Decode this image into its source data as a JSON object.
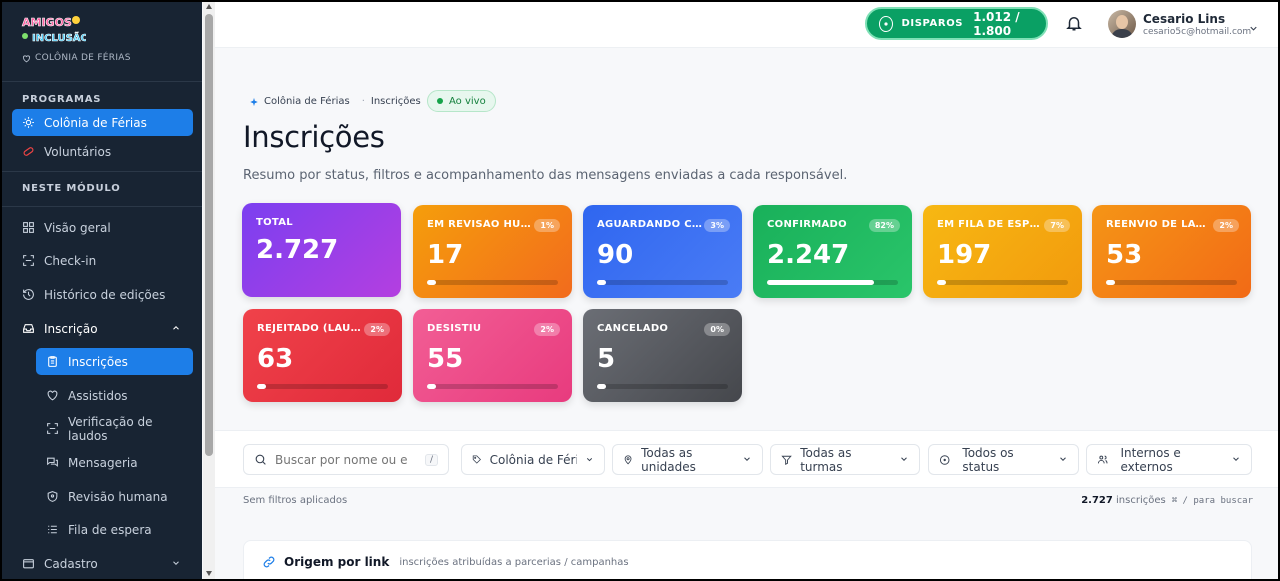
{
  "brand": {
    "logo_text_1": "AMIGOS",
    "logo_text_2": "INCLUSÃO",
    "subtitle": "COLÔNIA DE FÉRIAS"
  },
  "sidebar": {
    "section_programs": "PROGRAMAS",
    "programs": [
      {
        "label": "Colônia de Férias",
        "icon": "sun-icon",
        "active": true
      },
      {
        "label": "Voluntários",
        "icon": "pill-icon",
        "active": false
      }
    ],
    "section_module": "NESTE MÓDULO",
    "module_items": [
      {
        "label": "Visão geral",
        "icon": "grid-icon"
      },
      {
        "label": "Check-in",
        "icon": "scan-icon"
      },
      {
        "label": "Histórico de edições",
        "icon": "history-icon"
      },
      {
        "label": "Inscrição",
        "icon": "inbox-icon"
      }
    ],
    "sub_items": [
      {
        "label": "Inscrições",
        "icon": "clipboard-icon",
        "active": true
      },
      {
        "label": "Assistidos",
        "icon": "heart-icon"
      },
      {
        "label": "Verificação de laudos",
        "icon": "scan-icon"
      },
      {
        "label": "Mensageria",
        "icon": "chat-icon"
      },
      {
        "label": "Revisão humana",
        "icon": "shield-icon"
      },
      {
        "label": "Fila de espera",
        "icon": "list-icon"
      }
    ],
    "cadastro": {
      "label": "Cadastro",
      "icon": "folder-icon"
    }
  },
  "header": {
    "disparos_label": "DISPAROS",
    "disparos_value": "1.012 / 1.800",
    "user_name": "Cesario Lins",
    "user_email": "cesario5c@hotmail.com"
  },
  "breadcrumb": {
    "program": "Colônia de Férias",
    "page": "Inscrições",
    "status": "Ao vivo"
  },
  "page": {
    "title": "Inscrições",
    "subtitle": "Resumo por status, filtros e acompanhamento das mensagens enviadas a cada responsável."
  },
  "cards": [
    {
      "label": "TOTAL",
      "value": "2.727",
      "pct": "",
      "fill": 0
    },
    {
      "label": "EM REVISÃO HUMANA",
      "value": "17",
      "pct": "1%",
      "fill": 0.01
    },
    {
      "label": "AGUARDANDO CONFIRMAÇÃO",
      "value": "90",
      "pct": "3%",
      "fill": 0.03
    },
    {
      "label": "CONFIRMADO",
      "value": "2.247",
      "pct": "82%",
      "fill": 0.82
    },
    {
      "label": "EM FILA DE ESPERA",
      "value": "197",
      "pct": "7%",
      "fill": 0.07
    },
    {
      "label": "REENVIO DE LAUDO",
      "value": "53",
      "pct": "2%",
      "fill": 0.02
    },
    {
      "label": "REJEITADO (LAUDO)",
      "value": "63",
      "pct": "2%",
      "fill": 0.02
    },
    {
      "label": "DESISTIU",
      "value": "55",
      "pct": "2%",
      "fill": 0.02
    },
    {
      "label": "CANCELADO",
      "value": "5",
      "pct": "0%",
      "fill": 0.0
    }
  ],
  "colors": {
    "total": "#8b3fe6",
    "revisao": "#f28a14",
    "aguardando": "#3c6ef0",
    "confirmado": "#1dbb5d",
    "fila": "#f6b114",
    "reenvio": "#f27d16",
    "rejeitado": "#ef3b45",
    "desistiu": "#ef4f8c",
    "cancelado": "#55585e",
    "sidebar_bg": "#182433",
    "accent": "#1d7ee8",
    "disparos": "#0aa064"
  },
  "filters": {
    "search_placeholder": "Buscar por nome ou e-mail",
    "search_kbd": "/",
    "program": "Colônia de Férias ...",
    "units": "Todas as unidades",
    "classes": "Todas as turmas",
    "status": "Todos os status",
    "scope": "Internos e externos"
  },
  "info": {
    "no_filters": "Sem filtros aplicados",
    "count": "2.727",
    "count_label": "inscrições",
    "shortcut": "⌘ / para buscar"
  },
  "origin": {
    "title": "Origem por link",
    "subtitle": "inscrições atribuídas a parcerias / campanhas"
  }
}
